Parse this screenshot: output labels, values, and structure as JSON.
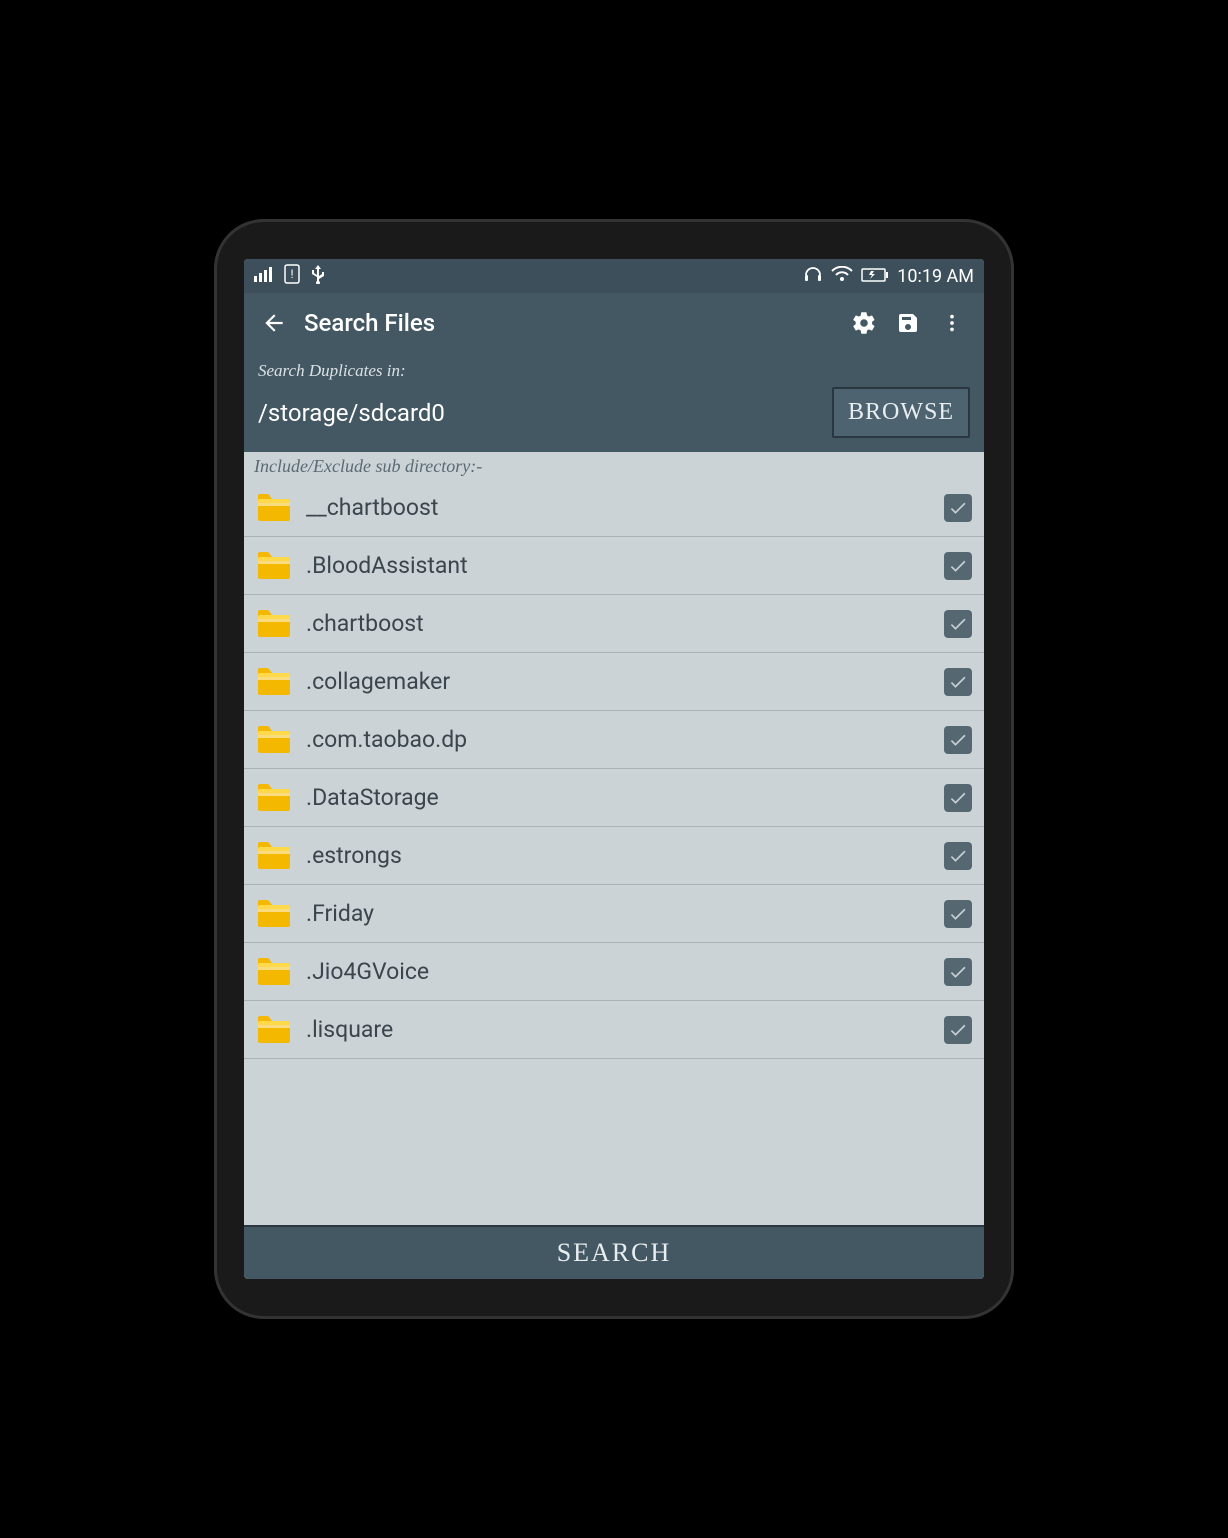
{
  "statusbar": {
    "time": "10:19 AM"
  },
  "appbar": {
    "title": "Search Files"
  },
  "search": {
    "label": "Search Duplicates in:",
    "path": "/storage/sdcard0",
    "browse_label": "BROWSE"
  },
  "subdir_label": "Include/Exclude sub directory:-",
  "folders": [
    {
      "name": "__chartboost",
      "checked": true
    },
    {
      "name": ".BloodAssistant",
      "checked": true
    },
    {
      "name": ".chartboost",
      "checked": true
    },
    {
      "name": ".collagemaker",
      "checked": true
    },
    {
      "name": ".com.taobao.dp",
      "checked": true
    },
    {
      "name": ".DataStorage",
      "checked": true
    },
    {
      "name": ".estrongs",
      "checked": true
    },
    {
      "name": ".Friday",
      "checked": true
    },
    {
      "name": ".Jio4GVoice",
      "checked": true
    },
    {
      "name": ".lisquare",
      "checked": true
    }
  ],
  "footer": {
    "search_label": "SEARCH"
  }
}
